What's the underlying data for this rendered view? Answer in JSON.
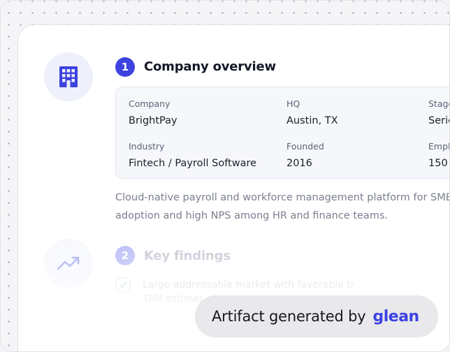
{
  "section1": {
    "number": "1",
    "title": "Company overview",
    "fields": [
      {
        "label": "Company",
        "value": "BrightPay"
      },
      {
        "label": "HQ",
        "value": "Austin, TX"
      },
      {
        "label": "Stage",
        "value": "Serie"
      },
      {
        "label": "Industry",
        "value": "Fintech / Payroll Software"
      },
      {
        "label": "Founded",
        "value": "2016"
      },
      {
        "label": "Emplo",
        "value": "150"
      }
    ],
    "description": [
      "Cloud-native payroll and workforce management platform for SMBs",
      "adoption and high NPS among HR and finance teams."
    ]
  },
  "section2": {
    "number": "2",
    "title": "Key findings",
    "finding_lines": [
      "Large addressable market with favorable tr",
      "TAM estimat"
    ]
  },
  "badge": {
    "text": "Artifact generated by",
    "brand": "glean"
  },
  "colors": {
    "accent": "#3d43e0",
    "accent_muted": "#b9bcf5",
    "avatar_bg": "#eef0fb",
    "success": "#c9ead5"
  },
  "icons": {
    "section1": "building-icon",
    "section2": "trending-up-icon",
    "finding": "check-circle-icon"
  }
}
